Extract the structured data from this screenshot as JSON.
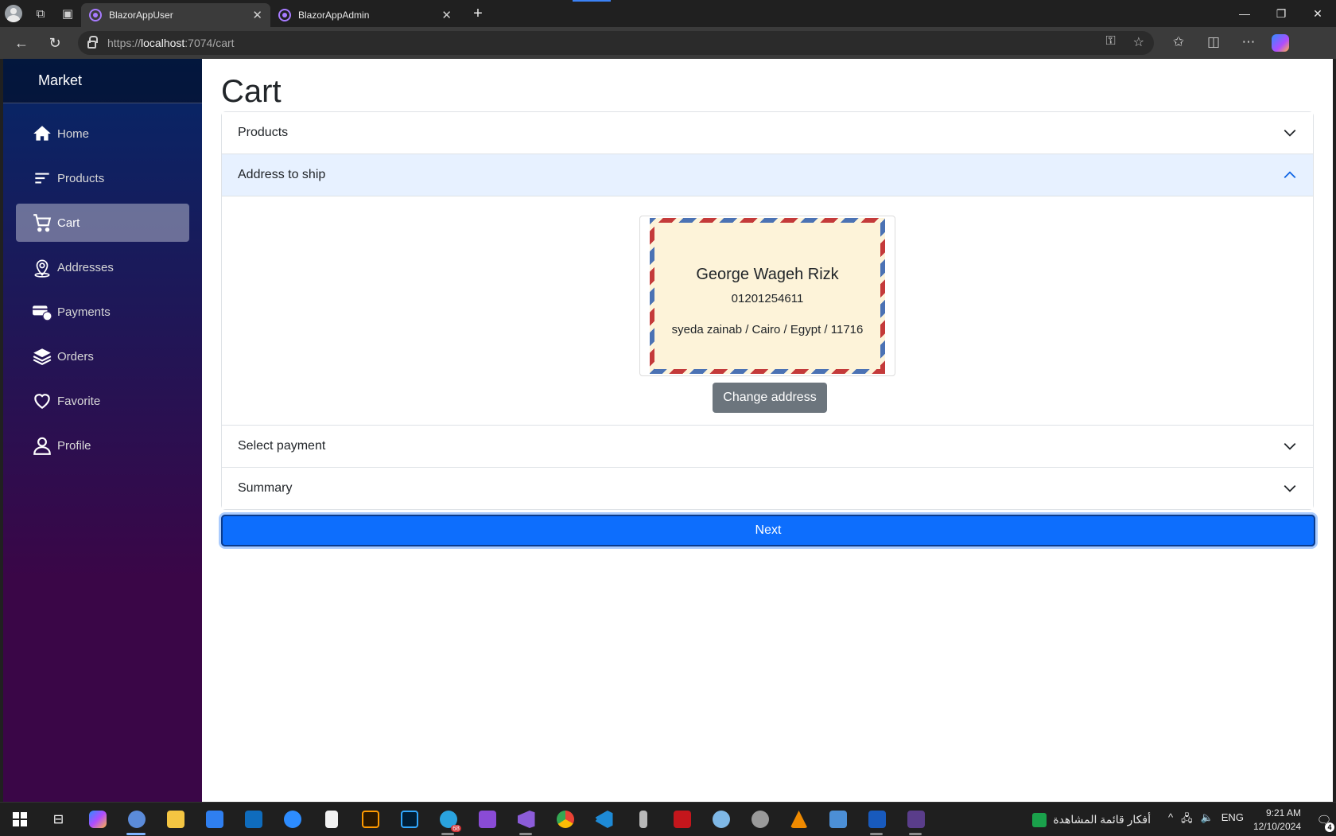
{
  "browser": {
    "tabs": [
      {
        "title": "BlazorAppUser",
        "active": true
      },
      {
        "title": "BlazorAppAdmin",
        "active": false
      }
    ],
    "url_prefix": "https://",
    "url_host": "localhost",
    "url_path": ":7074/cart"
  },
  "sidebar": {
    "brand": "Market",
    "items": [
      {
        "label": "Home",
        "icon": "home-icon"
      },
      {
        "label": "Products",
        "icon": "list-icon"
      },
      {
        "label": "Cart",
        "icon": "cart-icon",
        "active": true
      },
      {
        "label": "Addresses",
        "icon": "location-pin-icon"
      },
      {
        "label": "Payments",
        "icon": "payment-card-icon"
      },
      {
        "label": "Orders",
        "icon": "layers-icon"
      },
      {
        "label": "Favorite",
        "icon": "heart-icon"
      },
      {
        "label": "Profile",
        "icon": "person-icon"
      }
    ]
  },
  "main": {
    "title": "Cart",
    "accordion": [
      {
        "label": "Products",
        "expanded": false
      },
      {
        "label": "Address to ship",
        "expanded": true
      },
      {
        "label": "Select payment",
        "expanded": false
      },
      {
        "label": "Summary",
        "expanded": false
      }
    ],
    "address": {
      "name": "George Wageh Rizk",
      "phone": "01201254611",
      "line": "syeda zainab / Cairo / Egypt / 11716"
    },
    "change_address_label": "Change address",
    "next_label": "Next"
  },
  "taskbar": {
    "telegram_badge": "68",
    "news_text": "أفكار قائمة المشاهدة",
    "language": "ENG",
    "time": "9:21 AM",
    "date": "12/10/2024",
    "notifications": "4"
  },
  "colors": {
    "primary": "#0d6efd",
    "secondary": "#6c757d",
    "sidebar_top": "#052767",
    "sidebar_bottom": "#3a0647"
  }
}
